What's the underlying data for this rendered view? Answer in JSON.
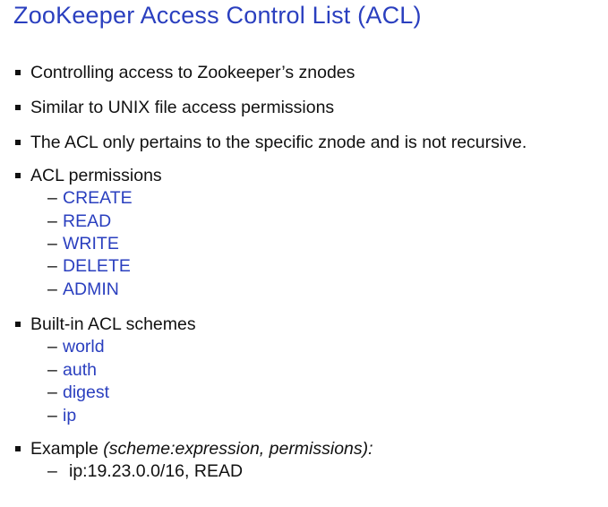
{
  "title": "ZooKeeper Access Control List (ACL)",
  "bullets": [
    "Controlling access to Zookeeper’s znodes",
    "Similar to UNIX file access permissions",
    "The ACL only pertains to the specific znode and is not recursive.",
    "ACL permissions",
    "Built-in ACL schemes"
  ],
  "permissions": [
    "CREATE",
    "READ",
    "WRITE",
    "DELETE",
    "ADMIN"
  ],
  "schemes": [
    "world",
    "auth",
    "digest",
    "ip"
  ],
  "example": {
    "label": "Example ",
    "format": "(scheme:expression, permissions):",
    "value": "ip:19.23.0.0/16, READ"
  },
  "dash": "–",
  "colors": {
    "accent": "#2a3fbf",
    "text": "#111111",
    "background": "#ffffff"
  }
}
